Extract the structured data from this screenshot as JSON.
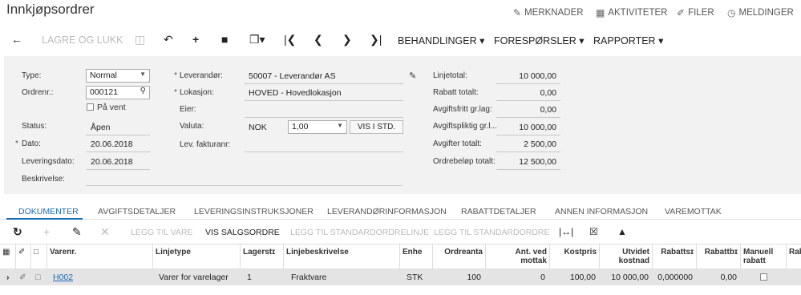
{
  "header": {
    "title": "Innkjøpsordrer",
    "links": [
      {
        "label": "MERKNADER",
        "icon": "edit-note-icon"
      },
      {
        "label": "AKTIVITETER",
        "icon": "calendar-icon"
      },
      {
        "label": "FILER",
        "icon": "paperclip-icon"
      },
      {
        "label": "MELDINGER",
        "icon": "alarm-icon"
      }
    ]
  },
  "toolbar": {
    "save_close": "LAGRE OG LUKK",
    "menus": [
      "BEHANDLINGER",
      "FORESPØRSLER",
      "RAPPORTER"
    ]
  },
  "form": {
    "type_label": "Type:",
    "type_value": "Normal",
    "ordrenr_label": "Ordrenr.:",
    "ordrenr_value": "000121",
    "paa_vent_label": "På vent",
    "status_label": "Status:",
    "status_value": "Åpen",
    "dato_label": "Dato:",
    "dato_value": "20.06.2018",
    "leveringsdato_label": "Leveringsdato:",
    "leveringsdato_value": "20.06.2018",
    "beskrivelse_label": "Beskrivelse:",
    "leverandor_label": "Leverandør:",
    "leverandor_value": "50007 - Leverandør AS",
    "lokasjon_label": "Lokasjon:",
    "lokasjon_value": "HOVED - Hovedlokasjon",
    "eier_label": "Eier:",
    "valuta_label": "Valuta:",
    "valuta_value": "NOK",
    "kurs_value": "1,00",
    "vis_std_label": "VIS I STD.",
    "lev_fakturanr_label": "Lev. fakturanr:",
    "totals": [
      {
        "label": "Linjetotal:",
        "value": "10 000,00"
      },
      {
        "label": "Rabatt totalt:",
        "value": "0,00"
      },
      {
        "label": "Avgiftsfritt gr.lag:",
        "value": "0,00"
      },
      {
        "label": "Avgiftspliktig gr.l...",
        "value": "10 000,00"
      },
      {
        "label": "Avgifter totalt:",
        "value": "2 500,00"
      },
      {
        "label": "Ordrebeløp totalt:",
        "value": "12 500,00"
      }
    ]
  },
  "tabs": [
    "DOKUMENTER",
    "AVGIFTSDETALJER",
    "LEVERINGSINSTRUKSJONER",
    "LEVERANDØRINFORMASJON",
    "RABATTDETALJER",
    "ANNEN INFORMASJON",
    "VAREMOTTAK"
  ],
  "grid_toolbar": {
    "legg_til_vare": "LEGG TIL VARE",
    "vis_salgsordre": "VIS SALGSORDRE",
    "legg_til_standard_linje": "LEGG TIL STANDARDORDRELINJE",
    "legg_til_standard": "LEGG TIL STANDARDORDRE"
  },
  "grid": {
    "columns": [
      "Varenr.",
      "Linjetype",
      "Lagerstɪ",
      "Linjebeskrivelse",
      "Enhe",
      "Ordreanta",
      "Ant. ved mottak",
      "Kostpris",
      "Utvidet kostnad",
      "Rabattsɪ",
      "Rabattbɪ",
      "Manuell rabatt",
      "Rab"
    ],
    "rows": [
      {
        "varenr": "H002",
        "linjetype": "Varer for varelager",
        "lager": "1",
        "beskrivelse": "Fraktvare",
        "enhet": "STK",
        "ordreantall": "100",
        "ant_mottak": "0",
        "kostpris": "100,00",
        "utvidet": "10 000,00",
        "rabattsats": "0,000000",
        "rabattbelop": "0,00"
      }
    ]
  }
}
